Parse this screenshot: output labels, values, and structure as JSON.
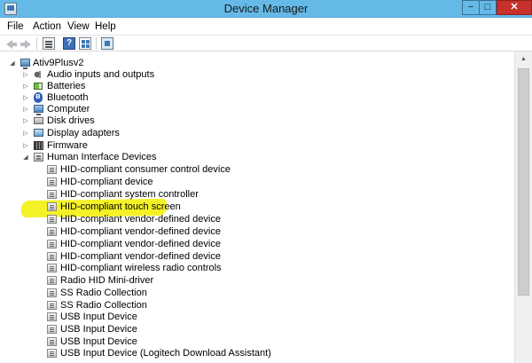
{
  "window": {
    "title": "Device Manager",
    "minimize_glyph": "−",
    "maximize_glyph": "□",
    "close_glyph": "✕"
  },
  "menu": {
    "file": "File",
    "action": "Action",
    "view": "View",
    "help": "Help"
  },
  "toolbar": {
    "icons": [
      "back-arrow-icon",
      "forward-arrow-icon",
      "properties-icon",
      "help-icon",
      "view-icon",
      "scan-hardware-icon"
    ],
    "help_glyph": "?"
  },
  "tree": {
    "root": "Ativ9Plusv2",
    "expander_collapsed": "▷",
    "expander_expanded": "◢",
    "categories": [
      {
        "label": "Audio inputs and outputs",
        "icon": "speaker-icon"
      },
      {
        "label": "Batteries",
        "icon": "battery-icon"
      },
      {
        "label": "Bluetooth",
        "icon": "bluetooth-icon"
      },
      {
        "label": "Computer",
        "icon": "computer-icon"
      },
      {
        "label": "Disk drives",
        "icon": "disk-drive-icon"
      },
      {
        "label": "Display adapters",
        "icon": "display-adapter-icon"
      },
      {
        "label": "Firmware",
        "icon": "firmware-icon"
      },
      {
        "label": "Human Interface Devices",
        "icon": "hid-icon"
      }
    ],
    "hid_children": [
      "HID-compliant consumer control device",
      "HID-compliant device",
      "HID-compliant system controller",
      "HID-compliant touch screen",
      "HID-compliant vendor-defined device",
      "HID-compliant vendor-defined device",
      "HID-compliant vendor-defined device",
      "HID-compliant vendor-defined device",
      "HID-compliant wireless radio controls",
      "Radio HID Mini-driver",
      "SS Radio Collection",
      "SS Radio Collection",
      "USB Input Device",
      "USB Input Device",
      "USB Input Device",
      "USB Input Device (Logitech Download Assistant)"
    ],
    "highlighted_item": "HID-compliant touch screen",
    "highlight_color": "#f2f000"
  },
  "colors": {
    "titlebar": "#64b9e6",
    "close_button": "#c7302b"
  },
  "scrollbar": {
    "up_glyph": "▲"
  }
}
